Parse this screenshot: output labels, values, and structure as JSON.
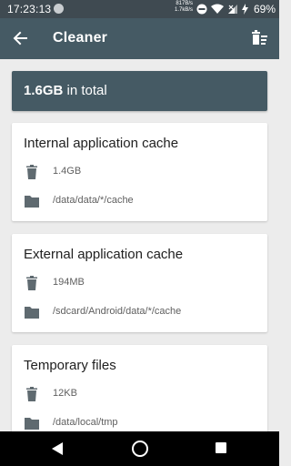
{
  "status_bar": {
    "time": "17:23:13",
    "speed_up": "817B/s",
    "speed_down": "1.7kB/s",
    "battery": "69%"
  },
  "app_bar": {
    "title": "Cleaner",
    "back_icon": "arrow-back-icon",
    "action_icon": "clean-trash-icon"
  },
  "total": {
    "value": "1.6GB",
    "suffix": " in total"
  },
  "cards": [
    {
      "title": "Internal application cache",
      "size": "1.4GB",
      "path": "/data/data/*/cache"
    },
    {
      "title": "External application cache",
      "size": "194MB",
      "path": "/sdcard/Android/data/*/cache"
    },
    {
      "title": "Temporary files",
      "size": "12KB",
      "path": "/data/local/tmp"
    }
  ],
  "colors": {
    "primary": "#455a64",
    "status_bar": "#3f4a51",
    "background": "#ececec",
    "icon": "#5f6a70"
  }
}
